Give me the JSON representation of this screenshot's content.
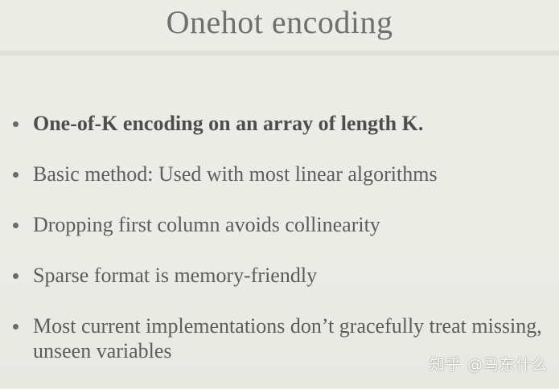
{
  "slide": {
    "title": "Onehot encoding",
    "bullets": [
      "One-of-K encoding on an array of length K.",
      "Basic method: Used with most linear algorithms",
      "Dropping first column avoids collinearity",
      "Sparse format is memory-friendly",
      "Most current implementations don’t gracefully treat missing, unseen variables"
    ]
  },
  "watermark": "知乎 @马东什么",
  "colors": {
    "background": "#ecece7",
    "title": "#6f6f6f",
    "text": "#5c5c5c"
  }
}
